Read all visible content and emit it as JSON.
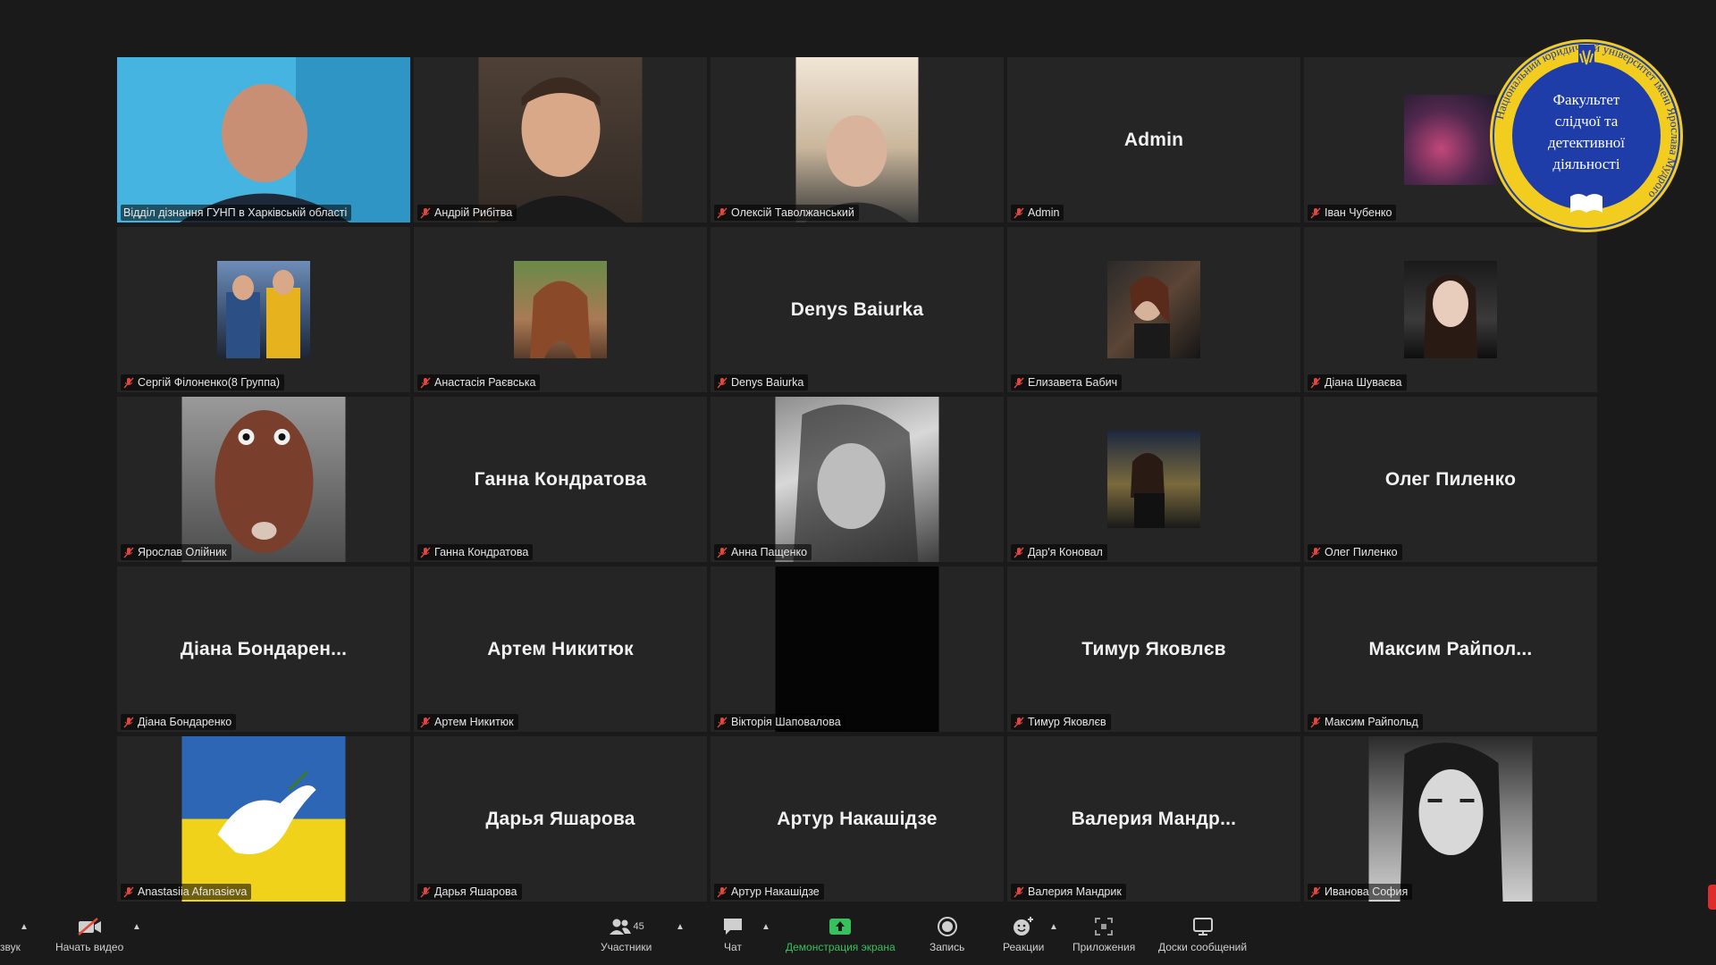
{
  "participants": [
    {
      "name": "Відділ дізнання ГУНП в Харківській області",
      "tile_text": ""
    },
    {
      "name": "Андрій Рибітва",
      "tile_text": ""
    },
    {
      "name": "Олексій Таволжанський",
      "tile_text": ""
    },
    {
      "name": "Admin",
      "tile_text": "Admin"
    },
    {
      "name": "Іван Чубенко",
      "tile_text": ""
    },
    {
      "name": "Сергій Філоненко(8 Группа)",
      "tile_text": ""
    },
    {
      "name": "Анастасія Раєвська",
      "tile_text": ""
    },
    {
      "name": "Denys Baiurka",
      "tile_text": "Denys Baiurka"
    },
    {
      "name": "Елизавета Бабич",
      "tile_text": ""
    },
    {
      "name": "Діана Шуваєва",
      "tile_text": ""
    },
    {
      "name": "Ярослав Олійник",
      "tile_text": ""
    },
    {
      "name": "Ганна Кондратова",
      "tile_text": "Ганна Кондратова"
    },
    {
      "name": "Анна Пащенко",
      "tile_text": ""
    },
    {
      "name": "Дар'я Коновал",
      "tile_text": ""
    },
    {
      "name": "Олег Пиленко",
      "tile_text": "Олег Пиленко"
    },
    {
      "name": "Діана Бондаренко",
      "tile_text": "Діана  Бондарен..."
    },
    {
      "name": "Артем Никитюк",
      "tile_text": "Артем Никитюк"
    },
    {
      "name": "Вікторія Шаповалова",
      "tile_text": ""
    },
    {
      "name": "Тимур Яковлєв",
      "tile_text": "Тимур Яковлєв"
    },
    {
      "name": "Максим Райпольд",
      "tile_text": "Максим  Райпол..."
    },
    {
      "name": "Anastasiia Afanasieva",
      "tile_text": ""
    },
    {
      "name": "Дарья Яшарова",
      "tile_text": "Дарья Яшарова"
    },
    {
      "name": "Артур Накашідзе",
      "tile_text": "Артур Накашідзе"
    },
    {
      "name": "Валерия Мандрик",
      "tile_text": "Валерия  Мандр..."
    },
    {
      "name": "Иванова София",
      "tile_text": ""
    }
  ],
  "emblem": {
    "line1": "Факультет",
    "line2": "слідчої та",
    "line3": "детективної",
    "line4": "діяльності",
    "ring_text": "Національний юридичний університет імені Ярослава Мудрого"
  },
  "toolbar": {
    "audio_label": "звук",
    "video_label": "Начать видео",
    "participants_label": "Участники",
    "participants_count": "45",
    "chat_label": "Чат",
    "share_label": "Демонстрация экрана",
    "record_label": "Запись",
    "reactions_label": "Реакции",
    "apps_label": "Приложения",
    "whiteboard_label": "Доски сообщений"
  },
  "colors": {
    "background": "#1a1a1a",
    "tile": "#252525",
    "active_speaker_border": "#d6e23a",
    "share_green": "#36c15c",
    "emblem_blue": "#1f3da8",
    "emblem_gold": "#f2cc1e",
    "muted_red": "#e0483e"
  }
}
